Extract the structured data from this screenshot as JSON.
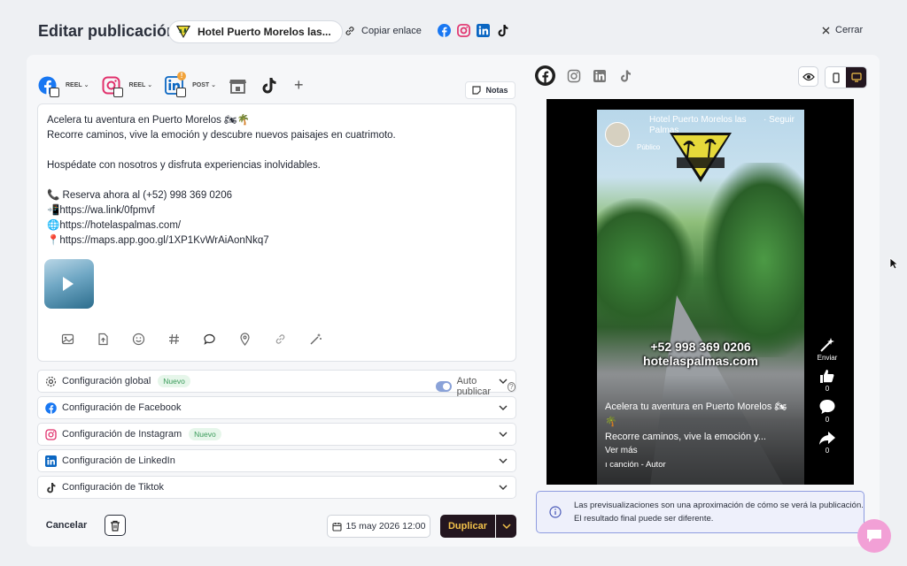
{
  "header": {
    "title": "Editar publicación",
    "account_name": "Hotel Puerto Morelos las...",
    "copy_link_label": "Copiar enlace",
    "close_label": "Cerrar"
  },
  "networks": [
    {
      "name": "facebook",
      "format": "REEL"
    },
    {
      "name": "instagram",
      "format": "REEL"
    },
    {
      "name": "linkedin",
      "format": "POST",
      "warning": "!"
    },
    {
      "name": "google-business"
    },
    {
      "name": "tiktok"
    }
  ],
  "add_network_label": "+",
  "notes_label": "Notas",
  "editor": {
    "lines": [
      "Acelera tu aventura en Puerto Morelos 🏍🌴",
      "Recorre caminos, vive la emoción y descubre nuevos paisajes en cuatrimoto.",
      "",
      "Hospédate con nosotros y disfruta experiencias inolvidables.",
      "",
      "📞 Reserva ahora al (+52) 998 369 0206",
      "📲https://wa.link/0fpmvf",
      "🌐https://hotelaspalmas.com/",
      "📍https://maps.app.goo.gl/1XP1KvWrAiAonNkq7"
    ]
  },
  "config": {
    "global": {
      "label": "Configuración global",
      "badge": "Nuevo",
      "autopublish_label": "Auto publicar",
      "help": "?"
    },
    "facebook": {
      "label": "Configuración de Facebook"
    },
    "instagram": {
      "label": "Configuración de Instagram",
      "badge": "Nuevo"
    },
    "linkedin": {
      "label": "Configuración de LinkedIn"
    },
    "tiktok": {
      "label": "Configuración de Tiktok"
    }
  },
  "footer": {
    "cancel_label": "Cancelar",
    "date": "15 may 2026 12:00",
    "duplicate_label": "Duplicar"
  },
  "preview": {
    "name": "Hotel Puerto Morelos las Palmas",
    "follow": "· Seguir",
    "public": "Público",
    "overlay_phone": "+52 998 369 0206",
    "overlay_site": "hotelaspalmas.com",
    "caption_line1": "Acelera tu aventura en Puerto Morelos 🏍",
    "caption_line2": "🌴",
    "caption_line3": "Recorre caminos, vive la emoción y...",
    "more": "Ver más",
    "song": "ı canción - Autor",
    "send_label": "Enviar",
    "likes": "0",
    "comments": "0",
    "shares": "0",
    "info_text": "Las previsualizaciones son una aproximación de cómo se verá la publicación. El resultado final puede ser diferente."
  },
  "colors": {
    "facebook": "#1877f2",
    "instagram": "#e1306c",
    "linkedin": "#0a66c2",
    "primary_dark": "#23161f",
    "primary_text": "#f3c24a",
    "badge_green": "#3a9b5a",
    "info_border": "#8e9ce0"
  }
}
